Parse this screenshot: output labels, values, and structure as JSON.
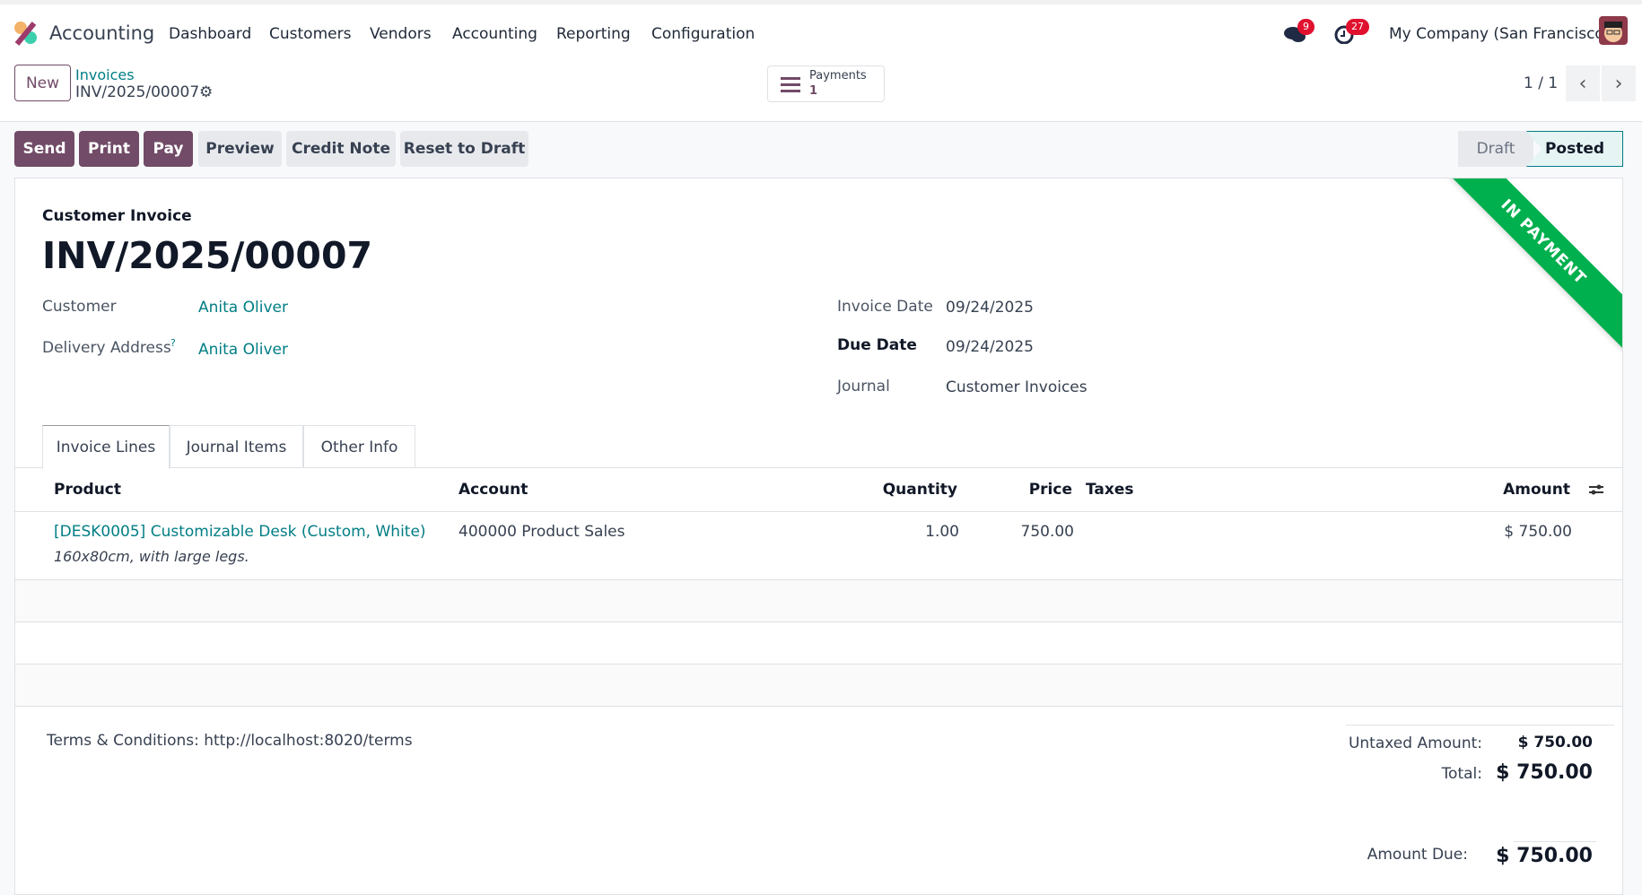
{
  "nav": {
    "app": "Accounting",
    "menu": [
      "Dashboard",
      "Customers",
      "Vendors",
      "Accounting",
      "Reporting",
      "Configuration"
    ],
    "messages_count": "9",
    "activities_count": "27",
    "company": "My Company (San Francisco)"
  },
  "control": {
    "new_label": "New",
    "breadcrumb_parent": "Invoices",
    "breadcrumb_current": "INV/2025/00007",
    "payments_label": "Payments",
    "payments_count": "1",
    "pager": "1 / 1"
  },
  "actions": {
    "send": "Send",
    "print": "Print",
    "pay": "Pay",
    "preview": "Preview",
    "credit_note": "Credit Note",
    "reset": "Reset to Draft"
  },
  "status": {
    "steps": [
      "Draft",
      "Posted"
    ],
    "current": "Posted"
  },
  "ribbon": "IN PAYMENT",
  "invoice": {
    "type": "Customer Invoice",
    "number": "INV/2025/00007",
    "customer_label": "Customer",
    "customer": "Anita Oliver",
    "delivery_label": "Delivery Address",
    "delivery_help": "?",
    "delivery": "Anita Oliver",
    "invoice_date_label": "Invoice Date",
    "invoice_date": "09/24/2025",
    "due_date_label": "Due Date",
    "due_date": "09/24/2025",
    "journal_label": "Journal",
    "journal": "Customer Invoices"
  },
  "tabs": [
    "Invoice Lines",
    "Journal Items",
    "Other Info"
  ],
  "table": {
    "headers": {
      "product": "Product",
      "account": "Account",
      "quantity": "Quantity",
      "price": "Price",
      "taxes": "Taxes",
      "amount": "Amount"
    },
    "rows": [
      {
        "product": "[DESK0005] Customizable Desk (Custom, White)",
        "description": "160x80cm, with large legs.",
        "account": "400000 Product Sales",
        "quantity": "1.00",
        "price": "750.00",
        "taxes": "",
        "amount": "$ 750.00"
      }
    ]
  },
  "terms": "Terms & Conditions: http://localhost:8020/terms",
  "totals": {
    "untaxed_label": "Untaxed Amount:",
    "untaxed": "$ 750.00",
    "total_label": "Total:",
    "total": "$ 750.00",
    "due_label": "Amount Due:",
    "due": "$ 750.00"
  }
}
